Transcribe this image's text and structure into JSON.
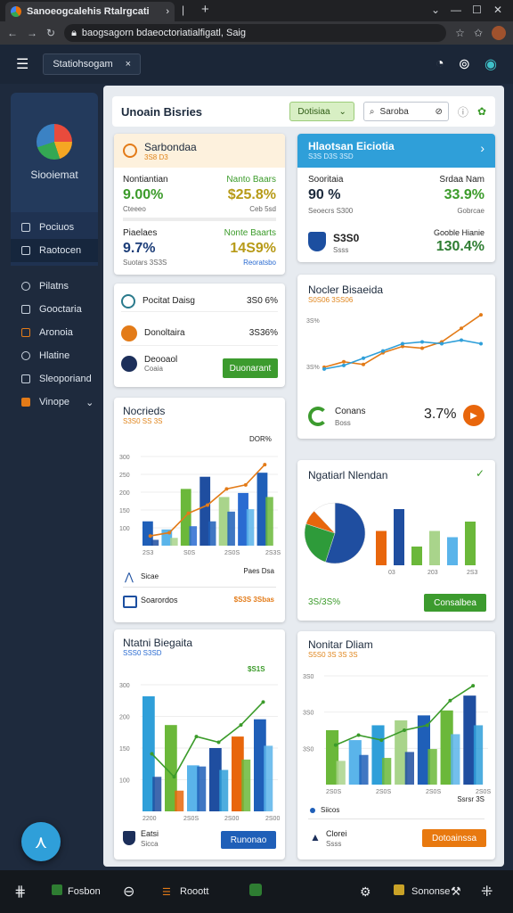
{
  "browser": {
    "tab_title": "Sanoeogcalehis Rtalrgcati",
    "url": "baogsagorn bdaeoctoriatialfigatl, Saig"
  },
  "app": {
    "header_tag": "Statiohsogam",
    "header_tag_close": "×"
  },
  "sidebar": {
    "brand": "Siooiemat",
    "items": [
      {
        "label": "Pociuos"
      },
      {
        "label": "Raotocen"
      },
      {
        "label": "Pilatns"
      },
      {
        "label": "Gooctaria"
      },
      {
        "label": "Aronoia"
      },
      {
        "label": "Hlatine"
      },
      {
        "label": "Sleoporiand"
      },
      {
        "label": "Vinope"
      }
    ]
  },
  "topbar": {
    "title": "Unoain Bisries",
    "filter": "Dotisiaa",
    "search": "Saroba"
  },
  "card1": {
    "title": "Sarbondaa",
    "sub": "3S8 D3",
    "r1_left_label": "Nontiantian",
    "r1_left_value": "9.00%",
    "r1_left_note": "Cteeeo",
    "r1_right_label": "Nanto Baars",
    "r1_right_value": "$25.8%",
    "r1_right_note": "Ceb 5sd",
    "r2_left_label": "Piaelaes",
    "r2_left_value": "9.7%",
    "r2_left_note": "Suotars 3S3S",
    "r2_right_label": "Nonte Baarts",
    "r2_right_value": "14S9%",
    "r2_right_note": "Reoratsbo"
  },
  "card2": {
    "title": "Hlaotsan Eiciotia",
    "sub": "S3S D3S 3SD",
    "left_label": "Sooritaia",
    "left_value": "90 %",
    "left_note": "Seoecrs S300",
    "right_label": "Srdaa Nam",
    "right_value": "33.9%",
    "right_note": "Gobrcae",
    "row2_left_value": "S3S0",
    "row2_left_note": "Ssss",
    "row2_right_label": "Gooble Hianie",
    "row2_right_value": "130.4%"
  },
  "card3": {
    "rows": [
      {
        "label": "Pocitat Daisg",
        "value": "3S0 6%"
      },
      {
        "label": "Donoltaira",
        "value": "3S36%"
      },
      {
        "label": "Deooaol",
        "sub": "Coaia"
      }
    ],
    "button": "Duonarant"
  },
  "card4": {
    "title": "Nocler Bisaeida",
    "sub": "S0S06 3SS06",
    "foot_label": "Conans",
    "foot_sub": "Boss",
    "foot_value": "3.7%"
  },
  "card5": {
    "title": "Nocrieds",
    "sub": "S3S0 SS 3S",
    "callout": "DOR%",
    "foot1_label": "Sicae",
    "foot1_right": "Paes Dsa",
    "foot2_label": "Soarordos",
    "foot2_value": "$S3S 3Sbas"
  },
  "card6": {
    "title": "Ngatiarl Nlendan",
    "foot_value": "3S/3S%",
    "button": "Consalbea"
  },
  "card7": {
    "title": "Ntatni Biegaita",
    "sub": "SSS0 S3SD",
    "callout": "$S1S",
    "foot_label": "Eatsi",
    "foot_sub": "Sicca",
    "button": "Runonao"
  },
  "card8": {
    "title": "Nonitar Dliam",
    "sub": "S5S0 3S 3S 3S",
    "foot_label": "Siicos",
    "foot_right": "Ssrsr 3S",
    "foot2_label": "Clorei",
    "foot2_sub": "Ssss",
    "button": "Dotoainssa"
  },
  "bottom": {
    "item1": "Fosbon",
    "item2": "Rooott",
    "item3": "Sononse"
  },
  "chart_data": [
    {
      "type": "line",
      "title": "Nocler Bisaeida",
      "ylabel": "",
      "ytick_labels": [
        "3S%",
        "3S%"
      ],
      "series": [
        {
          "values": [
            12,
            18,
            15,
            28,
            35,
            33,
            40,
            55,
            70
          ]
        },
        {
          "values": [
            10,
            14,
            22,
            30,
            38,
            40,
            38,
            42,
            38
          ]
        }
      ]
    },
    {
      "type": "bar",
      "title": "Nocrieds",
      "ytick_labels": [
        "300",
        "250",
        "200",
        "150",
        "100"
      ],
      "xtick_labels": [
        "2S3",
        "S0S",
        "2S0S",
        "2S3S"
      ],
      "series": [
        {
          "values": [
            30,
            20,
            70,
            85,
            60,
            65,
            90
          ]
        },
        {
          "values": [
            12,
            16,
            40,
            50,
            70,
            75,
            100
          ]
        }
      ]
    },
    {
      "type": "bar",
      "title": "Ngatiarl Nlendan",
      "xtick_labels": [
        "03",
        "203",
        "2S3"
      ],
      "series": [
        {
          "values": [
            55,
            90,
            30,
            55,
            45,
            70
          ]
        },
        {
          "values": [
            70,
            45,
            80,
            35,
            90,
            60
          ]
        }
      ]
    },
    {
      "type": "bar",
      "title": "Ntatni Biegaita",
      "ytick_labels": [
        "300",
        "200",
        "150",
        "100"
      ],
      "xtick_labels": [
        "2200",
        "2S0S",
        "2S00",
        "2S00"
      ],
      "series": [
        {
          "values": [
            100,
            75,
            40,
            55,
            65,
            80
          ]
        },
        {
          "values": [
            50,
            30,
            65,
            60,
            75,
            95
          ]
        }
      ]
    },
    {
      "type": "bar",
      "title": "Nonitar Dliam",
      "ytick_labels": [
        "3S0",
        "3S0",
        "3S0"
      ],
      "xtick_labels": [
        "2S0S",
        "2S0S",
        "2S0S",
        "2S0S"
      ],
      "series": [
        {
          "values": [
            55,
            45,
            60,
            65,
            70,
            75,
            90
          ]
        },
        {
          "values": [
            40,
            50,
            45,
            55,
            60,
            85,
            100
          ]
        }
      ]
    }
  ]
}
